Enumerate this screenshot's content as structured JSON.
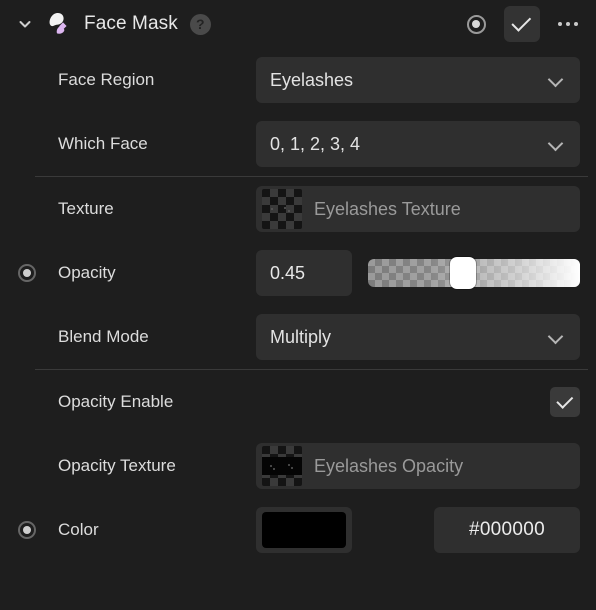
{
  "header": {
    "disclosure_icon": "chevron-down-icon",
    "node_icon": "face-mask-brush-icon",
    "title": "Face Mask",
    "help_label": "?",
    "record_icon": "record-keyframe-icon",
    "enabled_checked": true,
    "more_icon": "ellipsis-icon"
  },
  "rows": {
    "face_region": {
      "label": "Face Region",
      "value": "Eyelashes"
    },
    "which_face": {
      "label": "Which Face",
      "value": "0, 1, 2, 3, 4"
    },
    "texture": {
      "label": "Texture",
      "value": "Eyelashes Texture"
    },
    "opacity": {
      "label": "Opacity",
      "value": "0.45",
      "slider_percent": 45
    },
    "blend_mode": {
      "label": "Blend Mode",
      "value": "Multiply"
    },
    "opacity_enable": {
      "label": "Opacity Enable",
      "checked": true
    },
    "opacity_texture": {
      "label": "Opacity Texture",
      "value": "Eyelashes Opacity"
    },
    "color": {
      "label": "Color",
      "swatch_hex": "#000000",
      "hex_value": "#000000"
    }
  },
  "colors": {
    "panel_bg": "#1e1e1e",
    "field_bg": "#2f2f2f",
    "text": "#dcdcdc",
    "muted_text": "#9a9a9a",
    "divider": "#3a3a3a",
    "accent_icon": "#d9b8f0"
  }
}
